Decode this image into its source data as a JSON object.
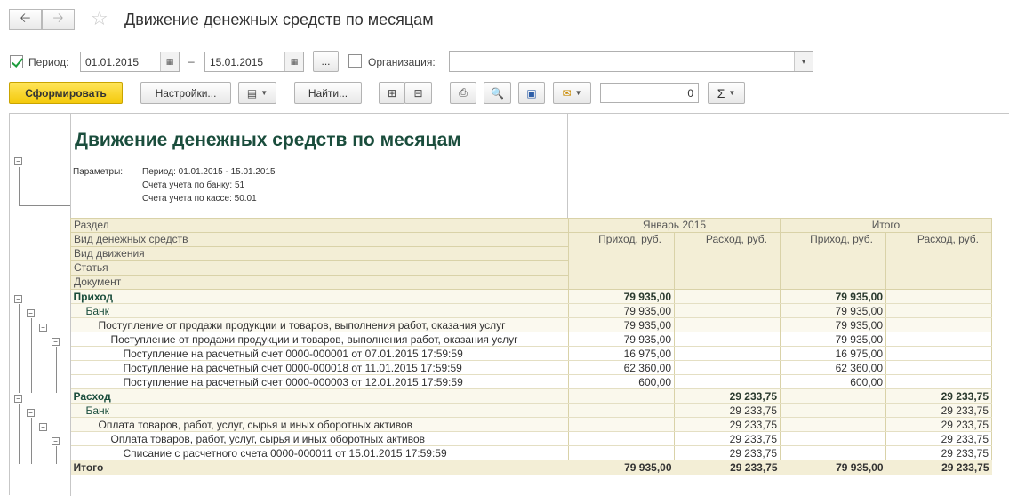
{
  "window": {
    "title": "Движение денежных средств по месяцам"
  },
  "form": {
    "period_label": "Период:",
    "date_from": "01.01.2015",
    "date_to": "15.01.2015",
    "dash": "–",
    "more_btn": "...",
    "org_label": "Организация:",
    "org_value": ""
  },
  "toolbar": {
    "generate": "Сформировать",
    "settings": "Настройки...",
    "find": "Найти...",
    "sum_value": "0",
    "sigma": "Σ"
  },
  "report": {
    "title": "Движение денежных средств по месяцам",
    "params_label": "Параметры:",
    "params": [
      "Период: 01.01.2015 - 15.01.2015",
      "Счета учета по банку: 51",
      "Счета учета по кассе: 50.01"
    ],
    "header_rows": [
      "Раздел",
      "Вид денежных средств",
      "Вид движения",
      "Статья",
      "Документ"
    ],
    "col_groups": [
      "Январь 2015",
      "Итого"
    ],
    "col_sub": [
      "Приход, руб.",
      "Расход, руб.",
      "Приход, руб.",
      "Расход, руб."
    ],
    "rows": [
      {
        "level": 1,
        "label": "Приход",
        "v": [
          "79 935,00",
          "",
          "79 935,00",
          ""
        ]
      },
      {
        "level": 2,
        "label": "Банк",
        "v": [
          "79 935,00",
          "",
          "79 935,00",
          ""
        ]
      },
      {
        "level": 3,
        "label": "Поступление от продажи продукции и товаров, выполнения работ, оказания услуг",
        "v": [
          "79 935,00",
          "",
          "79 935,00",
          ""
        ]
      },
      {
        "level": 4,
        "label": "Поступление от продажи продукции и товаров, выполнения работ, оказания услуг",
        "v": [
          "79 935,00",
          "",
          "79 935,00",
          ""
        ]
      },
      {
        "level": 5,
        "label": "Поступление на расчетный счет 0000-000001 от 07.01.2015 17:59:59",
        "v": [
          "16 975,00",
          "",
          "16 975,00",
          ""
        ]
      },
      {
        "level": 5,
        "label": "Поступление на расчетный счет 0000-000018 от 11.01.2015 17:59:59",
        "v": [
          "62 360,00",
          "",
          "62 360,00",
          ""
        ]
      },
      {
        "level": 5,
        "label": "Поступление на расчетный счет 0000-000003 от 12.01.2015 17:59:59",
        "v": [
          "600,00",
          "",
          "600,00",
          ""
        ]
      },
      {
        "level": 1,
        "label": "Расход",
        "v": [
          "",
          "29 233,75",
          "",
          "29 233,75"
        ]
      },
      {
        "level": 2,
        "label": "Банк",
        "v": [
          "",
          "29 233,75",
          "",
          "29 233,75"
        ]
      },
      {
        "level": 3,
        "label": "Оплата товаров, работ, услуг, сырья и иных оборотных активов",
        "v": [
          "",
          "29 233,75",
          "",
          "29 233,75"
        ]
      },
      {
        "level": 4,
        "label": "Оплата товаров, работ, услуг, сырья и иных оборотных активов",
        "v": [
          "",
          "29 233,75",
          "",
          "29 233,75"
        ]
      },
      {
        "level": 5,
        "label": "Списание с расчетного счета 0000-000011 от 15.01.2015 17:59:59",
        "v": [
          "",
          "29 233,75",
          "",
          "29 233,75"
        ]
      }
    ],
    "total": {
      "label": "Итого",
      "v": [
        "79 935,00",
        "29 233,75",
        "79 935,00",
        "29 233,75"
      ]
    }
  }
}
